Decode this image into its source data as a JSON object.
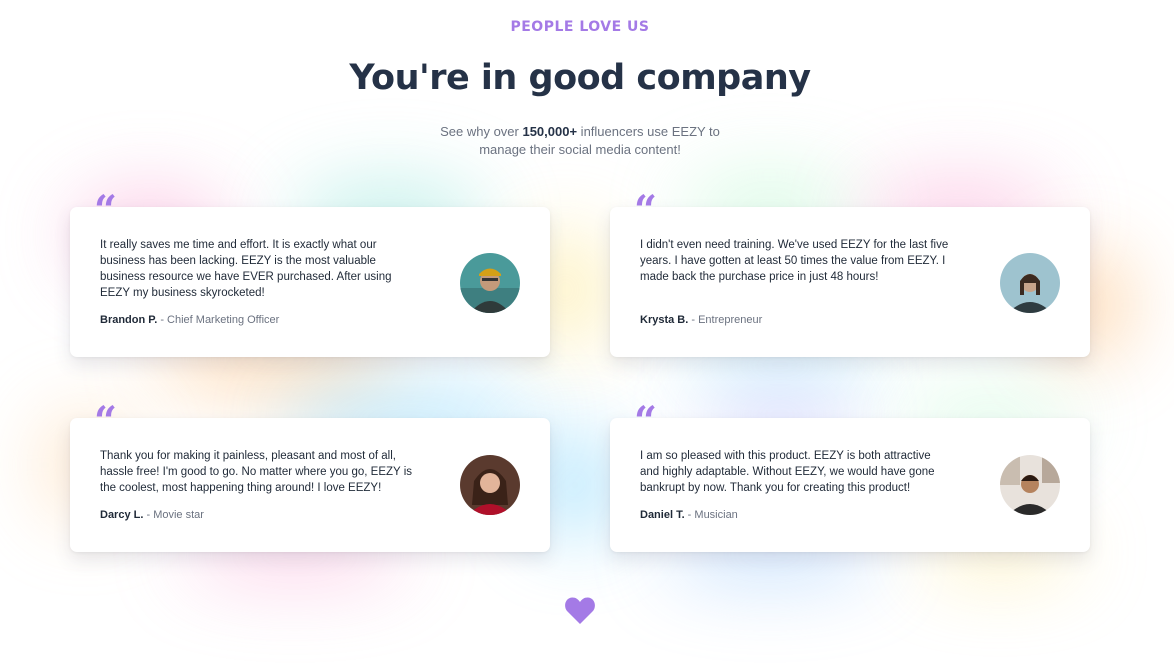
{
  "header": {
    "eyebrow": "PEOPLE LOVE US",
    "title": "You're in good company",
    "subtitle_before": "See why over ",
    "subtitle_bold": "150,000+",
    "subtitle_after": " influencers use EEZY to manage their social media content!"
  },
  "testimonials": [
    {
      "quote_mark": "“",
      "text": "It really saves me time and effort. It is exactly what our business has been lacking. EEZY is the most valuable business resource we have EVER purchased. After using EEZY my business skyrocketed!",
      "name": "Brandon P.",
      "role": " - Chief Marketing Officer"
    },
    {
      "quote_mark": "“",
      "text": "I didn't even need training. We've used EEZY for the last five years. I have gotten at least 50 times the value from EEZY. I made back the purchase price in just 48 hours!",
      "name": "Krysta B.",
      "role": " - Entrepreneur"
    },
    {
      "quote_mark": "“",
      "text": "Thank you for making it painless, pleasant and most of all, hassle free! I'm good to go. No matter where you go, EEZY is the coolest, most happening thing around! I love EEZY!",
      "name": "Darcy L.",
      "role": " - Movie star"
    },
    {
      "quote_mark": "“",
      "text": "I am so pleased with this product. EEZY is both attractive and highly adaptable. Without EEZY, we would have gone bankrupt by now. Thank you for creating this product!",
      "name": "Daniel T.",
      "role": " - Musician"
    }
  ],
  "colors": {
    "accent": "#a47ae6",
    "heading": "#253247",
    "muted": "#6b7280"
  },
  "icons": {
    "quote": "quote-icon",
    "heart": "heart-icon"
  }
}
